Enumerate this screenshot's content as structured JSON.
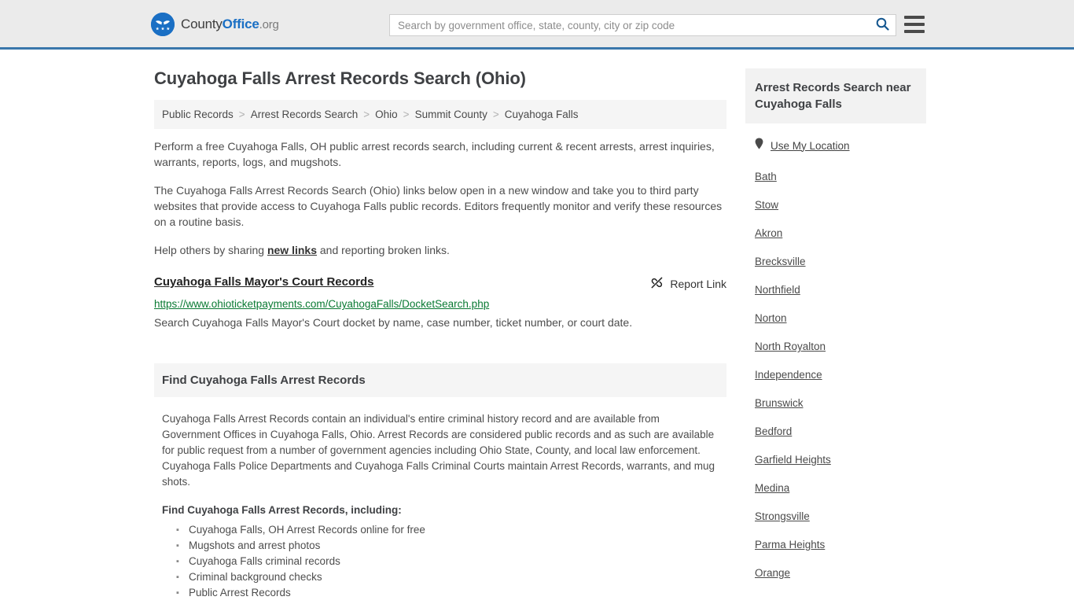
{
  "header": {
    "logo": {
      "icon": "eagle-crest-logo-icon",
      "text_county": "County",
      "text_office": "Office",
      "text_org": ".org",
      "brand_color": "#1a6fc4"
    },
    "search": {
      "placeholder": "Search by government office, state, county, city or zip code",
      "value": "",
      "icon": "search-icon"
    },
    "menu": {
      "icon": "hamburger-menu-icon",
      "label": "Menu"
    },
    "accent_border_color": "#3a77ab",
    "background_color": "#ebebeb"
  },
  "main": {
    "page_title": "Cuyahoga Falls Arrest Records Search (Ohio)",
    "breadcrumb": {
      "separator": ">",
      "items": [
        {
          "label": "Public Records",
          "current": false
        },
        {
          "label": "Arrest Records Search",
          "current": false
        },
        {
          "label": "Ohio",
          "current": false
        },
        {
          "label": "Summit County",
          "current": false
        },
        {
          "label": "Cuyahoga Falls",
          "current": true
        }
      ]
    },
    "intro": {
      "paragraph_1": "Perform a free Cuyahoga Falls, OH public arrest records search, including current & recent arrests, arrest inquiries, warrants, reports, logs, and mugshots.",
      "paragraph_2": "The Cuyahoga Falls Arrest Records Search (Ohio) links below open in a new window and take you to third party websites that provide access to Cuyahoga Falls public records. Editors frequently monitor and verify these resources on a routine basis.",
      "paragraph_3_before": "Help others by sharing ",
      "paragraph_3_link": "new links",
      "paragraph_3_after": " and reporting broken links."
    },
    "result": {
      "title": "Cuyahoga Falls Mayor's Court Records",
      "url": "https://www.ohioticketpayments.com/CuyahogaFalls/DocketSearch.php",
      "description": "Search Cuyahoga Falls Mayor's Court docket by name, case number, ticket number, or court date.",
      "report": {
        "label": "Report Link",
        "icon": "broken-link-icon"
      },
      "url_color": "#0a7a33"
    },
    "section": {
      "header": "Find Cuyahoga Falls Arrest Records",
      "paragraph": "Cuyahoga Falls Arrest Records contain an individual's entire criminal history record and are available from Government Offices in Cuyahoga Falls, Ohio. Arrest Records are considered public records and as such are available for public request from a number of government agencies including Ohio State, County, and local law enforcement. Cuyahoga Falls Police Departments and Cuyahoga Falls Criminal Courts maintain Arrest Records, warrants, and mug shots.",
      "list_heading": "Find Cuyahoga Falls Arrest Records, including:",
      "list_items": [
        "Cuyahoga Falls, OH Arrest Records online for free",
        "Mugshots and arrest photos",
        "Cuyahoga Falls criminal records",
        "Criminal background checks",
        "Public Arrest Records"
      ]
    }
  },
  "sidebar": {
    "header": "Arrest Records Search near Cuyahoga Falls",
    "use_my_location": {
      "label": "Use My Location",
      "icon": "map-pin-icon"
    },
    "cities": [
      "Bath",
      "Stow",
      "Akron",
      "Brecksville",
      "Northfield",
      "Norton",
      "North Royalton",
      "Independence",
      "Brunswick",
      "Bedford",
      "Garfield Heights",
      "Medina",
      "Strongsville",
      "Parma Heights",
      "Orange"
    ]
  }
}
